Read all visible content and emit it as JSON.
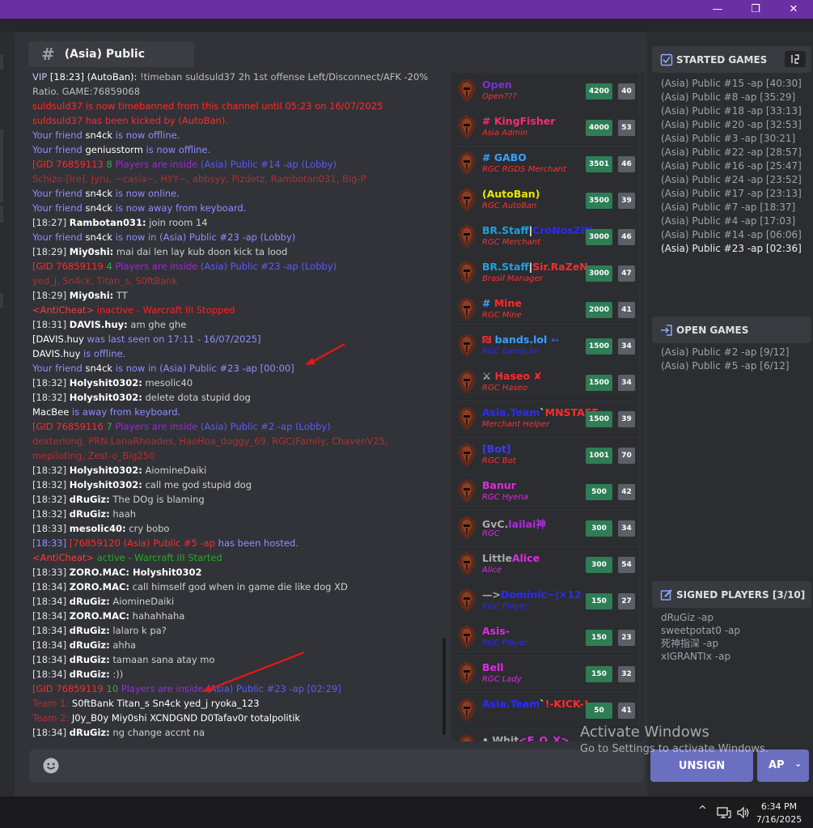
{
  "window": {
    "controls": {
      "minimize": "—",
      "restore": "❐",
      "close": "✕"
    }
  },
  "channel": {
    "hash": "#",
    "name": "(Asia) Public"
  },
  "chat": {
    "messages": [
      {
        "parts": [
          {
            "t": "VIP",
            "c": "#c8c8ff"
          },
          {
            "t": " [18:23] (AutoBan): ",
            "c": "#ffffff"
          },
          {
            "t": "!timeban suldsuld37 2h 1st offense Left/Disconnect/AFK -20%",
            "c": "#bdbdbd"
          }
        ]
      },
      {
        "parts": [
          {
            "t": "Ratio. GAME:76859068",
            "c": "#bdbdbd"
          }
        ]
      },
      {
        "parts": [
          {
            "t": "suldsuld37 is now timebanned from this channel until 05:23 on 16/07/2025",
            "c": "#ff2a2a"
          }
        ]
      },
      {
        "parts": [
          {
            "t": "suldsuld37 has been kicked by (AutoBan).",
            "c": "#ff2a2a"
          }
        ]
      },
      {
        "parts": [
          {
            "t": "Your friend ",
            "c": "#8f8fff"
          },
          {
            "t": "sn4ck",
            "c": "#ffffff"
          },
          {
            "t": " is now offline.",
            "c": "#8f8fff"
          }
        ]
      },
      {
        "parts": [
          {
            "t": "Your friend ",
            "c": "#8f8fff"
          },
          {
            "t": "geniusstorm",
            "c": "#ffffff"
          },
          {
            "t": " is now offline.",
            "c": "#8f8fff"
          }
        ]
      },
      {
        "parts": [
          {
            "t": "[GID 76859113",
            "c": "#ff2a2a"
          },
          {
            "t": " 8 ",
            "c": "#3faa3f"
          },
          {
            "t": "Players are inside ",
            "c": "#9a2ad9"
          },
          {
            "t": "(Asia) Public #14 -ap (Lobby)",
            "c": "#5a5aff"
          }
        ]
      },
      {
        "parts": [
          {
            "t": "Schizo-[lre], Jyru, ~casia~, HYY~, abbsyy, Pizdetz, Rambotan031, Big-P",
            "c": "#b03030"
          }
        ]
      },
      {
        "parts": [
          {
            "t": "Your friend ",
            "c": "#8f8fff"
          },
          {
            "t": "sn4ck",
            "c": "#ffffff"
          },
          {
            "t": " is now online.",
            "c": "#8f8fff"
          }
        ]
      },
      {
        "parts": [
          {
            "t": "Your friend ",
            "c": "#8f8fff"
          },
          {
            "t": "sn4ck",
            "c": "#ffffff"
          },
          {
            "t": " is now away from keyboard.",
            "c": "#8f8fff"
          }
        ]
      },
      {
        "parts": [
          {
            "t": "[18:27] ",
            "c": "#e0e0e0"
          },
          {
            "t": "Rambotan031:",
            "c": "#ffffff",
            "b": true
          },
          {
            "t": " join room 14",
            "c": "#d0d0d0"
          }
        ]
      },
      {
        "parts": [
          {
            "t": "Your friend ",
            "c": "#8f8fff"
          },
          {
            "t": "sn4ck",
            "c": "#ffffff"
          },
          {
            "t": " is now in (Asia) Public #23 -ap (Lobby)",
            "c": "#8f8fff"
          }
        ]
      },
      {
        "parts": [
          {
            "t": "[18:29] ",
            "c": "#e0e0e0"
          },
          {
            "t": "Miy0shi:",
            "c": "#ffffff",
            "b": true
          },
          {
            "t": " mai dai len lay kub doon kick ta lood",
            "c": "#d0d0d0"
          }
        ]
      },
      {
        "parts": [
          {
            "t": "[GID 76859119",
            "c": "#ff2a2a"
          },
          {
            "t": " 4 ",
            "c": "#3faa3f"
          },
          {
            "t": "Players are inside ",
            "c": "#9a2ad9"
          },
          {
            "t": "(Asia) Public #23 -ap (Lobby)",
            "c": "#5a5aff"
          }
        ]
      },
      {
        "parts": [
          {
            "t": "yed_j, Sn4ck, Titan_s, S0ftBank",
            "c": "#b03030"
          }
        ]
      },
      {
        "parts": [
          {
            "t": "[18:29] ",
            "c": "#e0e0e0"
          },
          {
            "t": "Miy0shi:",
            "c": "#ffffff",
            "b": true
          },
          {
            "t": " TT",
            "c": "#d0d0d0"
          }
        ]
      },
      {
        "parts": [
          {
            "t": "<AntiCheat> ",
            "c": "#ff3a3a"
          },
          {
            "t": "inactive - Warcraft III Stopped",
            "c": "#ff2020"
          }
        ]
      },
      {
        "parts": [
          {
            "t": "[18:31] ",
            "c": "#e0e0e0"
          },
          {
            "t": "DAVIS.huy:",
            "c": "#ffffff",
            "b": true
          },
          {
            "t": " am ghe ghe",
            "c": "#d0d0d0"
          }
        ]
      },
      {
        "parts": [
          {
            "t": "[DAVIS.huy",
            "c": "#ffffff"
          },
          {
            "t": " was last seen on 17:11 - 16/07/2025]",
            "c": "#8f8fff"
          }
        ]
      },
      {
        "parts": [
          {
            "t": "DAVIS.huy",
            "c": "#ffffff"
          },
          {
            "t": " is offline.",
            "c": "#8f8fff"
          }
        ]
      },
      {
        "parts": [
          {
            "t": "Your friend ",
            "c": "#8f8fff"
          },
          {
            "t": "sn4ck",
            "c": "#ffffff"
          },
          {
            "t": " is now in (Asia) Public #23 -ap [00:00]",
            "c": "#8f8fff"
          }
        ]
      },
      {
        "parts": [
          {
            "t": "[18:32] ",
            "c": "#e0e0e0"
          },
          {
            "t": "Holyshit0302:",
            "c": "#ffffff",
            "b": true
          },
          {
            "t": " mesolic40",
            "c": "#d0d0d0"
          }
        ]
      },
      {
        "parts": [
          {
            "t": "[18:32] ",
            "c": "#e0e0e0"
          },
          {
            "t": "Holyshit0302:",
            "c": "#ffffff",
            "b": true
          },
          {
            "t": " delete dota stupid dog",
            "c": "#d0d0d0"
          }
        ]
      },
      {
        "parts": [
          {
            "t": "MacBee",
            "c": "#ffffff"
          },
          {
            "t": " is away from keyboard.",
            "c": "#8f8fff"
          }
        ]
      },
      {
        "parts": [
          {
            "t": "[GID 76859116",
            "c": "#ff2a2a"
          },
          {
            "t": " 7 ",
            "c": "#3faa3f"
          },
          {
            "t": "Players are inside ",
            "c": "#9a2ad9"
          },
          {
            "t": "(Asia) Public #2 -ap (Lobby)",
            "c": "#5a5aff"
          }
        ]
      },
      {
        "wrap": true,
        "parts": [
          {
            "t": "dexterlong, PRN.LanaRhoades, HaoHoa_doggy_69, RGC(Family, ChavenV25, mepiloting, Zest-o_Big250",
            "c": "#b03030"
          }
        ]
      },
      {
        "parts": [
          {
            "t": "[18:32] ",
            "c": "#e0e0e0"
          },
          {
            "t": "Holyshit0302:",
            "c": "#ffffff",
            "b": true
          },
          {
            "t": " AiomineDaiki",
            "c": "#d0d0d0"
          }
        ]
      },
      {
        "parts": [
          {
            "t": "[18:32] ",
            "c": "#e0e0e0"
          },
          {
            "t": "Holyshit0302:",
            "c": "#ffffff",
            "b": true
          },
          {
            "t": " call me god stupid dog",
            "c": "#d0d0d0"
          }
        ]
      },
      {
        "parts": [
          {
            "t": "[18:32] ",
            "c": "#e0e0e0"
          },
          {
            "t": "dRuGiz:",
            "c": "#ffffff",
            "b": true
          },
          {
            "t": " The DOg is blaming",
            "c": "#d0d0d0"
          }
        ]
      },
      {
        "parts": [
          {
            "t": "[18:32] ",
            "c": "#e0e0e0"
          },
          {
            "t": "dRuGiz:",
            "c": "#ffffff",
            "b": true
          },
          {
            "t": " haah",
            "c": "#d0d0d0"
          }
        ]
      },
      {
        "parts": [
          {
            "t": "[18:33] ",
            "c": "#e0e0e0"
          },
          {
            "t": "mesolic40:",
            "c": "#ffffff",
            "b": true
          },
          {
            "t": " cry bobo",
            "c": "#d0d0d0"
          }
        ]
      },
      {
        "parts": [
          {
            "t": "[18:33] ",
            "c": "#8f8fff"
          },
          {
            "t": "[76859120",
            "c": "#ff2a2a"
          },
          {
            "t": " (Asia) Public #5 -ap",
            "c": "#ff2a2a"
          },
          {
            "t": " has been hosted.",
            "c": "#8f8fff"
          }
        ]
      },
      {
        "parts": [
          {
            "t": "<AntiCheat> ",
            "c": "#ff3a3a"
          },
          {
            "t": "active - Warcraft III Started",
            "c": "#2aa82a"
          }
        ]
      },
      {
        "parts": [
          {
            "t": "[18:33] ",
            "c": "#e0e0e0"
          },
          {
            "t": "ZORO.MAC:",
            "c": "#ffffff",
            "b": true
          },
          {
            "t": " Holyshit0302",
            "c": "#ffffff",
            "b": true
          }
        ]
      },
      {
        "parts": [
          {
            "t": "[18:34] ",
            "c": "#e0e0e0"
          },
          {
            "t": "ZORO.MAC:",
            "c": "#ffffff",
            "b": true
          },
          {
            "t": " call himself god when in game die like dog XD",
            "c": "#d0d0d0"
          }
        ]
      },
      {
        "parts": [
          {
            "t": "[18:34] ",
            "c": "#e0e0e0"
          },
          {
            "t": "dRuGiz:",
            "c": "#ffffff",
            "b": true
          },
          {
            "t": " AiomineDaiki",
            "c": "#d0d0d0"
          }
        ]
      },
      {
        "parts": [
          {
            "t": "[18:34] ",
            "c": "#e0e0e0"
          },
          {
            "t": "ZORO.MAC:",
            "c": "#ffffff",
            "b": true
          },
          {
            "t": " hahahhaha",
            "c": "#d0d0d0"
          }
        ]
      },
      {
        "parts": [
          {
            "t": "[18:34] ",
            "c": "#e0e0e0"
          },
          {
            "t": "dRuGiz:",
            "c": "#ffffff",
            "b": true
          },
          {
            "t": " lalaro k pa?",
            "c": "#d0d0d0"
          }
        ]
      },
      {
        "parts": [
          {
            "t": "[18:34] ",
            "c": "#e0e0e0"
          },
          {
            "t": "dRuGiz:",
            "c": "#ffffff",
            "b": true
          },
          {
            "t": " ahha",
            "c": "#d0d0d0"
          }
        ]
      },
      {
        "parts": [
          {
            "t": "[18:34] ",
            "c": "#e0e0e0"
          },
          {
            "t": "dRuGiz:",
            "c": "#ffffff",
            "b": true
          },
          {
            "t": " tamaan sana atay mo",
            "c": "#d0d0d0"
          }
        ]
      },
      {
        "parts": [
          {
            "t": "[18:34] ",
            "c": "#e0e0e0"
          },
          {
            "t": "dRuGiz:",
            "c": "#ffffff",
            "b": true
          },
          {
            "t": " :))",
            "c": "#d0d0d0"
          }
        ]
      },
      {
        "parts": [
          {
            "t": "[GID 76859119",
            "c": "#ff2a2a"
          },
          {
            "t": " 10 ",
            "c": "#3faa3f"
          },
          {
            "t": "Players are inside ",
            "c": "#9a2ad9"
          },
          {
            "t": "(Asia) Public #23 -ap [02:29]",
            "c": "#5a5aff"
          }
        ]
      },
      {
        "parts": [
          {
            "t": "Team 1:",
            "c": "#b03030"
          },
          {
            "t": "    S0ftBank    Titan_s    Sn4ck    yed_j    ryoka_123",
            "c": "#ffffff"
          }
        ]
      },
      {
        "parts": [
          {
            "t": "Team 2:",
            "c": "#b03030"
          },
          {
            "t": "    J0y_B0y    Miy0shi    XCNDGND    D0Tafav0r    totalpolitik",
            "c": "#ffffff"
          }
        ]
      },
      {
        "parts": [
          {
            "t": "[18:34] ",
            "c": "#e0e0e0"
          },
          {
            "t": "dRuGiz:",
            "c": "#ffffff",
            "b": true
          },
          {
            "t": " ng change accnt na",
            "c": "#d0d0d0"
          }
        ]
      }
    ]
  },
  "players": [
    {
      "name": [
        {
          "t": "Open",
          "c": "#7a2fd0"
        }
      ],
      "title": "Open???",
      "tcolor": "#ff3030",
      "score": "4200",
      "level": "40"
    },
    {
      "name": [
        {
          "t": "# KingFisher",
          "c": "#ff2a6a"
        }
      ],
      "title": "Asia Admin",
      "tcolor": "#ff3030",
      "score": "4000",
      "level": "53"
    },
    {
      "name": [
        {
          "t": "# GABO",
          "c": "#3aa0ff"
        }
      ],
      "title": "RGC RGDS Merchant",
      "tcolor": "#ff3030",
      "score": "3501",
      "level": "46"
    },
    {
      "name": [
        {
          "t": "(AutoBan)",
          "c": "#e8e800"
        }
      ],
      "title": "RGC AutoBan",
      "tcolor": "#ff3030",
      "score": "3500",
      "level": "39"
    },
    {
      "name": [
        {
          "t": "BR.Staff",
          "c": "#1ea0e0"
        },
        {
          "t": "|",
          "c": "#ffffff"
        },
        {
          "t": "CroNosZIN",
          "c": "#2a2aff"
        }
      ],
      "title": "RGC Merchant",
      "tcolor": "#ff3030",
      "score": "3000",
      "level": "46"
    },
    {
      "name": [
        {
          "t": "BR.Staff",
          "c": "#1ea0e0"
        },
        {
          "t": "|",
          "c": "#ffffff"
        },
        {
          "t": "Sir.RaZeN",
          "c": "#ff2a2a"
        }
      ],
      "title": "Brasil Manager",
      "tcolor": "#ff3030",
      "score": "3000",
      "level": "47"
    },
    {
      "name": [
        {
          "t": "# ",
          "c": "#3aa0ff"
        },
        {
          "t": "Mine",
          "c": "#ff2a2a"
        }
      ],
      "title": "RGC Mine",
      "tcolor": "#ff3030",
      "score": "2000",
      "level": "41"
    },
    {
      "name": [
        {
          "t": "₪ ",
          "c": "#ff2a2a"
        },
        {
          "t": "bands.lol",
          "c": "#3aa0ff"
        },
        {
          "t": " ➳",
          "c": "#3a6aff"
        }
      ],
      "title": "RGC bands.lol",
      "tcolor": "#2a2aff",
      "score": "1500",
      "level": "34"
    },
    {
      "name": [
        {
          "t": "⚔ ",
          "c": "#dddddd"
        },
        {
          "t": "Haseo",
          "c": "#ff2a2a"
        },
        {
          "t": " ✘",
          "c": "#ff2a2a"
        }
      ],
      "title": "RGC Haseo",
      "tcolor": "#ff3030",
      "score": "1500",
      "level": "34"
    },
    {
      "name": [
        {
          "t": "Asia.Team",
          "c": "#2a2aff"
        },
        {
          "t": "`",
          "c": "#ffffff"
        },
        {
          "t": "MNSTAFF",
          "c": "#ff2a2a"
        }
      ],
      "title": "Merchant Helper",
      "tcolor": "#ff3030",
      "score": "1500",
      "level": "39"
    },
    {
      "name": [
        {
          "t": "[Bot]",
          "c": "#3a3aff"
        }
      ],
      "title": "RGC Bot",
      "tcolor": "#ff3030",
      "score": "1001",
      "level": "70"
    },
    {
      "name": [
        {
          "t": "Banur",
          "c": "#e02ae0"
        }
      ],
      "title": "RGC Hyena",
      "tcolor": "#e02ae0",
      "score": "500",
      "level": "42"
    },
    {
      "name": [
        {
          "t": "GvC.",
          "c": "#aaaaaa"
        },
        {
          "t": "lailai神",
          "c": "#b02ae0"
        }
      ],
      "title": "RGC",
      "tcolor": "#e02ae0",
      "score": "300",
      "level": "34"
    },
    {
      "name": [
        {
          "t": "Little",
          "c": "#aaaaaa"
        },
        {
          "t": "Alice",
          "c": "#e02ae0"
        }
      ],
      "title": "Alice",
      "tcolor": "#e02ae0",
      "score": "300",
      "level": "54"
    },
    {
      "name": [
        {
          "t": "—>",
          "c": "#aaaaaa"
        },
        {
          "t": "Dominic~|×12",
          "c": "#2a2aff"
        }
      ],
      "title": "RGC Player",
      "tcolor": "#2a2aff",
      "score": "150",
      "level": "27"
    },
    {
      "name": [
        {
          "t": "Asis-",
          "c": "#e02ae0"
        }
      ],
      "title": "RGC Player",
      "tcolor": "#2a2aff",
      "score": "150",
      "level": "23"
    },
    {
      "name": [
        {
          "t": "Bell",
          "c": "#e02ae0"
        }
      ],
      "title": "RGC Lady",
      "tcolor": "#e02ae0",
      "score": "150",
      "level": "32"
    },
    {
      "name": [
        {
          "t": "Asia.Team",
          "c": "#2a2aff"
        },
        {
          "t": "`",
          "c": "#ffffff"
        },
        {
          "t": "!-KICK-!",
          "c": "#ff2a2a"
        }
      ],
      "title": "",
      "tcolor": "#ff3030",
      "score": "50",
      "level": "41"
    },
    {
      "name": [
        {
          "t": "• Whit",
          "c": "#aaaaaa"
        },
        {
          "t": "<F_O_X>",
          "c": "#e02ae0"
        }
      ],
      "title": "",
      "tcolor": "#ff3030",
      "score": "",
      "level": ""
    }
  ],
  "started_games": {
    "title": "STARTED GAMES",
    "items": [
      "(Asia) Public #15 -ap [40:30]",
      "(Asia) Public #8 -ap [35:29]",
      "(Asia) Public #18 -ap [33:13]",
      "(Asia) Public #20 -ap [32:53]",
      "(Asia) Public #3 -ap [30:21]",
      "(Asia) Public #22 -ap [28:57]",
      "(Asia) Public #16 -ap [25:47]",
      "(Asia) Public #24 -ap [23:52]",
      "(Asia) Public #17 -ap [23:13]",
      "(Asia) Public #7 -ap [18:37]",
      "(Asia) Public #4 -ap [17:03]",
      "(Asia) Public #14 -ap [06:06]"
    ],
    "current": "(Asia) Public #23 -ap [02:36]"
  },
  "open_games": {
    "title": "OPEN GAMES",
    "items": [
      "(Asia) Public #2 -ap [9/12]",
      "(Asia) Public #5 -ap [6/12]"
    ]
  },
  "signed_players": {
    "title": "SIGNED PLAYERS [3/10]",
    "items": [
      "dRuGiz -ap",
      "sweetpotat0 -ap",
      "死神指深 -ap",
      "xIGRANTIx -ap"
    ]
  },
  "buttons": {
    "unsign": "UNSIGN",
    "ap": "AP",
    "ap_chevron": "⌄"
  },
  "watermark": {
    "line1": "Activate Windows",
    "line2": "Go to Settings to activate Windows."
  },
  "taskbar": {
    "time": "6:34 PM",
    "date": "7/16/2025",
    "tray_chevron": "^"
  },
  "colors": {
    "titlebar": "#6a2fa3",
    "main_bg": "#313338",
    "panel_bg": "#2b2d31",
    "score_badge": "#2e7d55",
    "level_badge": "#5c5f66",
    "button": "#6b6fc0"
  }
}
